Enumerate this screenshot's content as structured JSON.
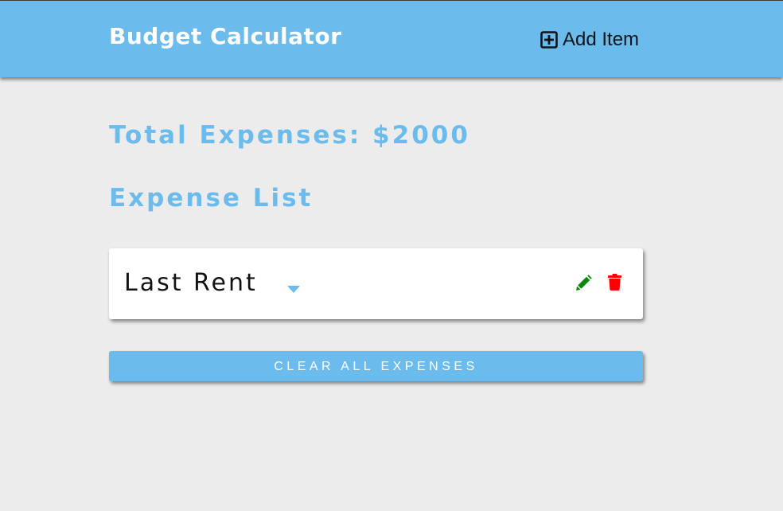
{
  "header": {
    "title": "Budget Calculator",
    "add_item_label": "Add Item"
  },
  "summary": {
    "total_label": "Total Expenses: $2000"
  },
  "expense_list": {
    "title": "Expense List",
    "items": [
      {
        "name": "Last Rent",
        "expand_icon": "caret-down-icon",
        "edit_icon": "pencil-icon",
        "delete_icon": "trash-icon"
      }
    ]
  },
  "actions": {
    "clear_all_label": "CLEAR ALL EXPENSES"
  },
  "colors": {
    "accent": "#6bbbec",
    "background": "#ececec",
    "edit": "#0a8a0a",
    "delete": "#ff0000"
  }
}
